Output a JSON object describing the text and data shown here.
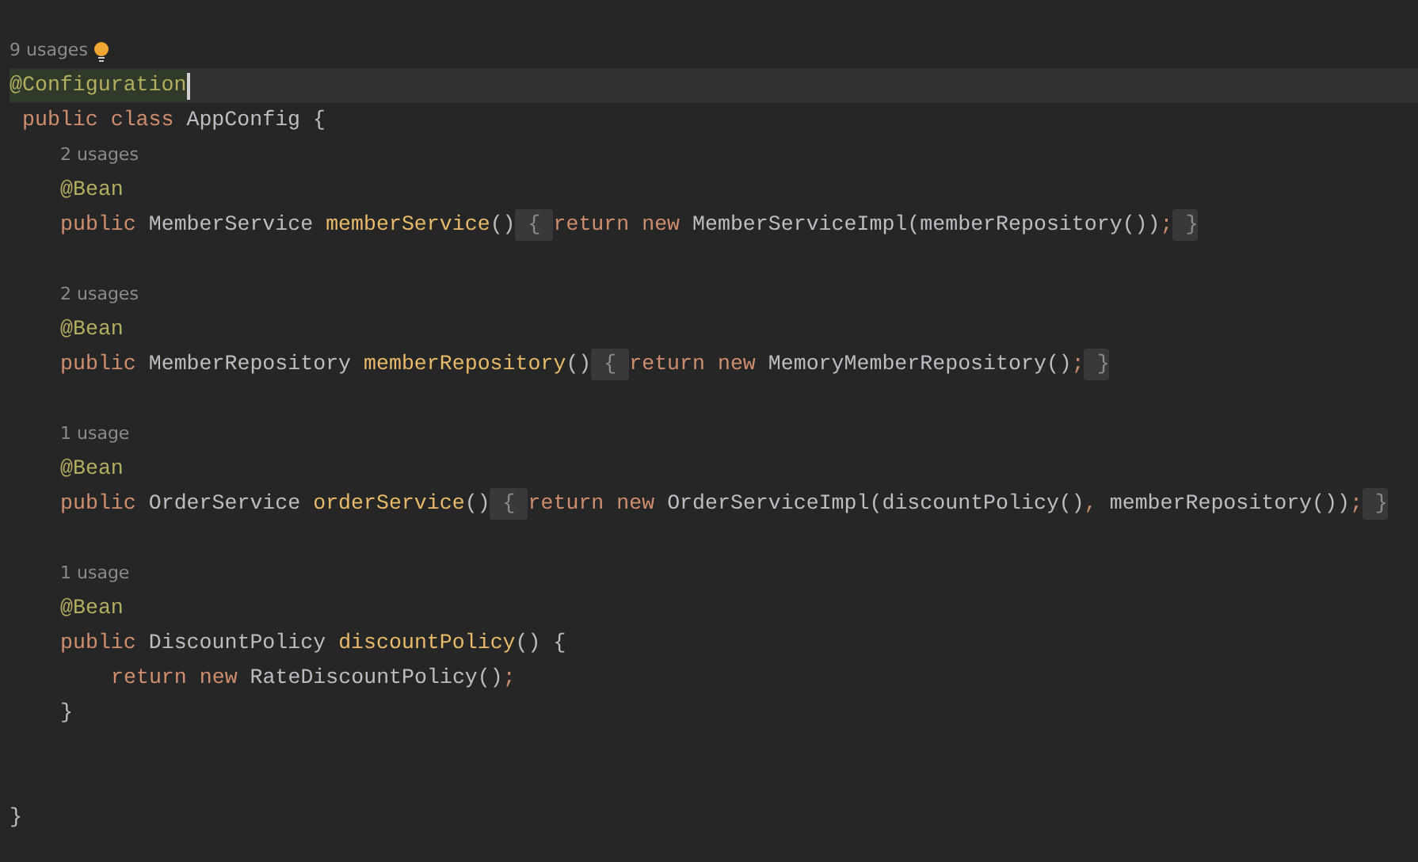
{
  "editor": {
    "lines": [
      {
        "bulb": true,
        "tokens": [
          {
            "kind": "hint",
            "text": "9 usages"
          }
        ]
      },
      {
        "current": true,
        "caret": true,
        "tokens": [
          {
            "kind": "annotation_match",
            "text": "@Configuration"
          }
        ]
      },
      {
        "tokens": [
          {
            "kind": "keyword",
            "text": " public class "
          },
          {
            "kind": "plain",
            "text": "AppConfig {"
          }
        ],
        "children": [
          {
            "tokens": [
              {
                "kind": "hint",
                "text": "2 usages"
              }
            ]
          },
          {
            "tokens": [
              {
                "kind": "annotation",
                "text": "@Bean"
              }
            ]
          },
          {
            "tokens": [
              {
                "kind": "keyword",
                "text": "public "
              },
              {
                "kind": "plain",
                "text": "MemberService "
              },
              {
                "kind": "method",
                "text": "memberService"
              },
              {
                "kind": "plain",
                "text": "()"
              },
              {
                "kind": "fold",
                "text": " { "
              },
              {
                "kind": "keyword",
                "text": "return new "
              },
              {
                "kind": "plain",
                "text": "MemberServiceImpl(memberRepository())"
              },
              {
                "kind": "keyword",
                "text": ";"
              },
              {
                "kind": "fold",
                "text": " }"
              }
            ]
          },
          {
            "tokens": [
              {
                "kind": "hint",
                "text": "2 usages"
              }
            ]
          },
          {
            "tokens": [
              {
                "kind": "annotation",
                "text": "@Bean"
              }
            ]
          },
          {
            "tokens": [
              {
                "kind": "keyword",
                "text": "public "
              },
              {
                "kind": "plain",
                "text": "MemberRepository "
              },
              {
                "kind": "method",
                "text": "memberRepository"
              },
              {
                "kind": "plain",
                "text": "()"
              },
              {
                "kind": "fold",
                "text": " { "
              },
              {
                "kind": "keyword",
                "text": "return new "
              },
              {
                "kind": "plain",
                "text": "MemoryMemberRepository()"
              },
              {
                "kind": "keyword",
                "text": ";"
              },
              {
                "kind": "fold",
                "text": " }"
              }
            ]
          },
          {
            "tokens": [
              {
                "kind": "hint",
                "text": "1 usage"
              }
            ]
          },
          {
            "tokens": [
              {
                "kind": "annotation",
                "text": "@Bean"
              }
            ]
          },
          {
            "tokens": [
              {
                "kind": "keyword",
                "text": "public "
              },
              {
                "kind": "plain",
                "text": "OrderService "
              },
              {
                "kind": "method",
                "text": "orderService"
              },
              {
                "kind": "plain",
                "text": "()"
              },
              {
                "kind": "fold",
                "text": " { "
              },
              {
                "kind": "keyword",
                "text": "return new "
              },
              {
                "kind": "plain",
                "text": "OrderServiceImpl(discountPolicy()"
              },
              {
                "kind": "keyword",
                "text": ", "
              },
              {
                "kind": "plain",
                "text": "memberRepository())"
              },
              {
                "kind": "keyword",
                "text": ";"
              },
              {
                "kind": "fold",
                "text": " }"
              }
            ]
          },
          {
            "tokens": [
              {
                "kind": "hint",
                "text": "1 usage"
              }
            ]
          },
          {
            "tokens": [
              {
                "kind": "annotation",
                "text": "@Bean"
              }
            ]
          },
          {
            "tokens": [
              {
                "kind": "keyword",
                "text": "public "
              },
              {
                "kind": "plain",
                "text": "DiscountPolicy "
              },
              {
                "kind": "method",
                "text": "discountPolicy"
              },
              {
                "kind": "plain",
                "text": "() {"
              }
            ],
            "children": [
              {
                "tokens": [
                  {
                    "kind": "keyword",
                    "text": "return new "
                  },
                  {
                    "kind": "plain",
                    "text": "RateDiscountPolicy()"
                  },
                  {
                    "kind": "keyword",
                    "text": ";"
                  }
                ]
              }
            ]
          },
          {
            "tokens": [
              {
                "kind": "plain",
                "text": "}"
              }
            ]
          }
        ]
      },
      {
        "tokens": [
          {
            "kind": "plain",
            "text": "}"
          }
        ]
      }
    ]
  }
}
